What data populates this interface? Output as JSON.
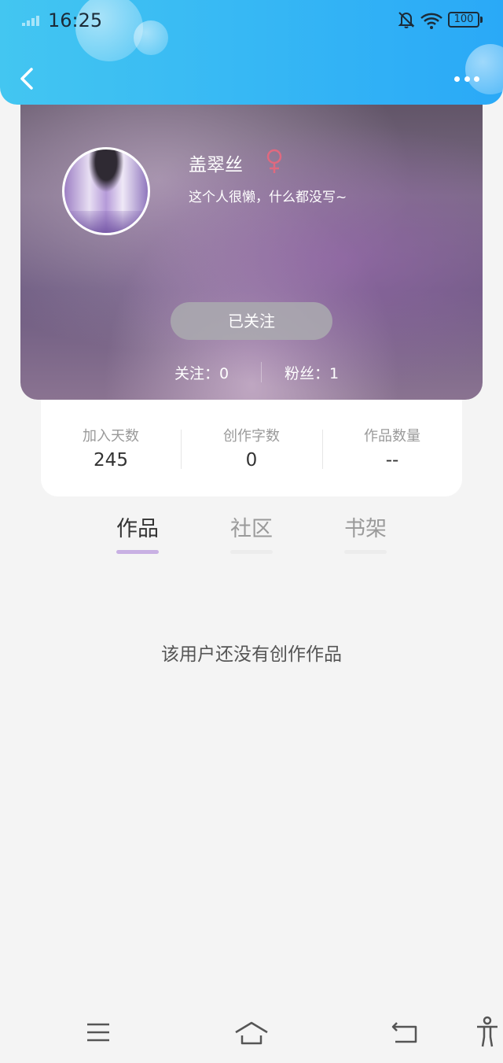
{
  "status_bar": {
    "time": "16:25",
    "battery": "100"
  },
  "header": {
    "back_icon": "chevron-left-icon",
    "more_icon": "more-dots-icon"
  },
  "profile": {
    "username": "盖翠丝",
    "gender_symbol": "♀",
    "gender_color": "#e0697f",
    "bio": "这个人很懒，什么都没写~",
    "follow_button": "已关注",
    "following_label": "关注：0",
    "fans_label": "粉丝：1"
  },
  "stats": [
    {
      "label": "加入天数",
      "value": "245"
    },
    {
      "label": "创作字数",
      "value": "0"
    },
    {
      "label": "作品数量",
      "value": "--"
    }
  ],
  "tabs": [
    {
      "label": "作品",
      "active": true
    },
    {
      "label": "社区",
      "active": false
    },
    {
      "label": "书架",
      "active": false
    }
  ],
  "empty_message": "该用户还没有创作作品",
  "bottom_nav": [
    "menu-icon",
    "home-icon",
    "back-icon",
    "accessibility-icon"
  ],
  "colors": {
    "header_start": "#43c6f1",
    "header_end": "#2aa9f7",
    "tab_indicator": "#c8b0e3"
  }
}
